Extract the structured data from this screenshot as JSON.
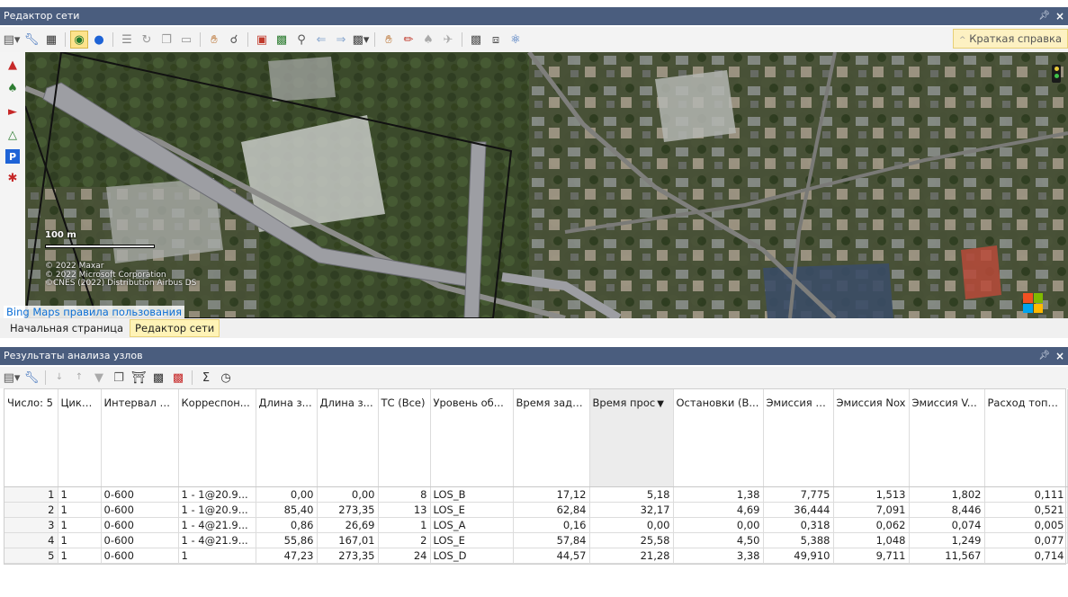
{
  "network_editor": {
    "title": "Редактор сети",
    "pin": "ᵖ",
    "close": "×",
    "help_button": "Краткая справка",
    "help_chevron": "^"
  },
  "map": {
    "scale_label": "100 m",
    "copyright_lines": [
      "© 2022 Maxar",
      "© 2022 Microsoft Corporation",
      "©CNES (2022) Distribution Airbus DS"
    ],
    "bing_terms": "Bing Maps правила пользования"
  },
  "tabs": [
    {
      "label": "Начальная страница",
      "active": false
    },
    {
      "label": "Редактор сети",
      "active": true
    }
  ],
  "results": {
    "title": "Результаты анализа узлов",
    "pin": "ᵖ",
    "close": "×",
    "columns": [
      "Число: 5",
      "Цикл...",
      "Интервал в...",
      "Корреспон...",
      "Длина з...",
      "Длина з...",
      "ТС (Все)",
      "Уровень об...",
      "Время заде...",
      "Время прос",
      "Остановки (В...",
      "Эмиссия CO",
      "Эмиссия Nox",
      "Эмиссия V...",
      "Расход топли..."
    ],
    "rows": [
      [
        "1",
        "1",
        "0-600",
        "1 - 1@20.9...",
        "0,00",
        "0,00",
        "8",
        "LOS_B",
        "17,12",
        "5,18",
        "1,38",
        "7,775",
        "1,513",
        "1,802",
        "0,111"
      ],
      [
        "2",
        "1",
        "0-600",
        "1 - 1@20.9...",
        "85,40",
        "273,35",
        "13",
        "LOS_E",
        "62,84",
        "32,17",
        "4,69",
        "36,444",
        "7,091",
        "8,446",
        "0,521"
      ],
      [
        "3",
        "1",
        "0-600",
        "1 - 4@21.9...",
        "0,86",
        "26,69",
        "1",
        "LOS_A",
        "0,16",
        "0,00",
        "0,00",
        "0,318",
        "0,062",
        "0,074",
        "0,005"
      ],
      [
        "4",
        "1",
        "0-600",
        "1 - 4@21.9...",
        "55,86",
        "167,01",
        "2",
        "LOS_E",
        "57,84",
        "25,58",
        "4,50",
        "5,388",
        "1,048",
        "1,249",
        "0,077"
      ],
      [
        "5",
        "1",
        "0-600",
        "1",
        "47,23",
        "273,35",
        "24",
        "LOS_D",
        "44,57",
        "21,28",
        "3,38",
        "49,910",
        "9,711",
        "11,567",
        "0,714"
      ]
    ]
  },
  "colors": {
    "titlebar": "#4a5d7e",
    "active_tab": "#fff3b6",
    "link": "#0d6fd6"
  }
}
